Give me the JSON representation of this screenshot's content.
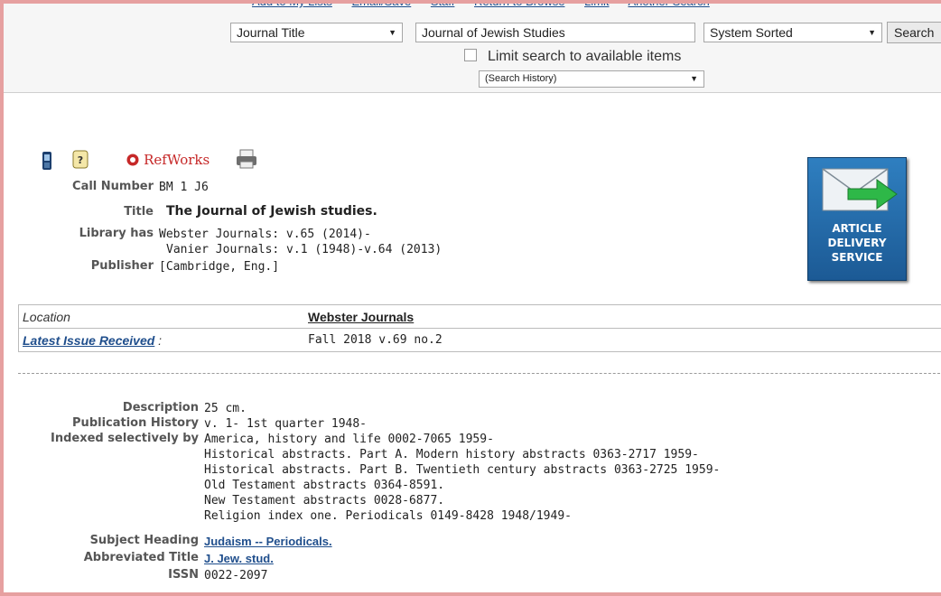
{
  "nav_links": [
    "Add to My Lists",
    "Email/Save",
    "Staff",
    "Return to Browse",
    "Limit",
    "Another Search"
  ],
  "search": {
    "search_type": "Journal Title",
    "query": "Journal of Jewish Studies",
    "sort": "System Sorted",
    "search_button": "Search",
    "limit_label": "Limit search to available items",
    "history": "(Search History)"
  },
  "toolbar": {
    "refworks_label": "RefWorks"
  },
  "record": {
    "call_number_label": "Call Number",
    "call_number": "BM 1 J6",
    "title_label": "Title",
    "title": "The Journal of Jewish studies.",
    "library_has_label": "Library has",
    "library_has": [
      "Webster Journals: v.65 (2014)-",
      "Vanier Journals: v.1 (1948)-v.64 (2013)"
    ],
    "publisher_label": "Publisher",
    "publisher": "[Cambridge, Eng.]"
  },
  "article_delivery": {
    "line1": "ARTICLE",
    "line2": "DELIVERY",
    "line3": "SERVICE"
  },
  "holdings": {
    "location_label": "Location",
    "location_value": "Webster Journals",
    "latest_label": "Latest Issue Received",
    "latest_sep": " :",
    "latest_value": "Fall 2018 v.69 no.2"
  },
  "details": {
    "description_label": "Description",
    "description": "25 cm.",
    "pub_history_label": "Publication History",
    "pub_history": "v. 1- 1st quarter 1948-",
    "indexed_label": "Indexed selectively by",
    "indexed": [
      "America, history and life 0002-7065 1959-",
      "Historical abstracts. Part A. Modern history abstracts 0363-2717 1959-",
      "Historical abstracts. Part B. Twentieth century abstracts 0363-2725 1959-",
      "Old Testament abstracts 0364-8591.",
      "New Testament abstracts 0028-6877.",
      "Religion index one. Periodicals 0149-8428 1948/1949-"
    ],
    "subject_label": "Subject Heading",
    "subject": "Judaism -- Periodicals.",
    "abbrev_label": "Abbreviated Title",
    "abbrev": "J. Jew. stud.",
    "issn_label": "ISSN",
    "issn": "0022-2097"
  }
}
